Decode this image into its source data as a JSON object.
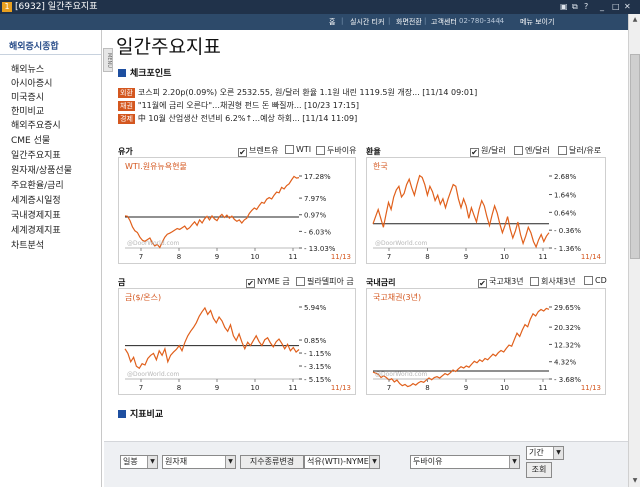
{
  "window": {
    "number": "1",
    "title": "[6932] 일간주요지표"
  },
  "topnav": {
    "items": [
      "홈",
      "실시간 티커",
      "화면전환",
      "고객센터"
    ],
    "phone": "02-780-3444",
    "menu": "메뉴 보이기"
  },
  "sidebar": {
    "header": "해외증시종합",
    "tab_label": "MENU",
    "items": [
      "해외뉴스",
      "아시아증시",
      "미국증시",
      "한미비교",
      "해외주요증시",
      "CME 선물",
      "일간주요지표",
      "원자재/상품선물",
      "주요환율/금리",
      "세계증시일정",
      "국내경제지표",
      "세계경제지표",
      "차트분석"
    ]
  },
  "page": {
    "title": "일간주요지표"
  },
  "checkpoint": {
    "title": "체크포인트",
    "news": [
      {
        "tag": "외환",
        "text": "코스피 2.20p(0.09%) 오른 2532.55, 원/달러 환율 1.1원 내린 1119.5원 개장... [11/14 09:01]"
      },
      {
        "tag": "채권",
        "text": "\"11월에 금리 오른다\"…채권형 펀드 돈 빠질까... [10/23 17:15]"
      },
      {
        "tag": "경제",
        "text": "中 10월 산업생산 전년비 6.2%↑…예상 하회... [11/14 11:09]"
      }
    ]
  },
  "panels": {
    "oil": {
      "title": "유가",
      "options": [
        {
          "label": "브렌트유",
          "checked": true
        },
        {
          "label": "WTI",
          "checked": false
        },
        {
          "label": "두바이유",
          "checked": false
        }
      ],
      "series_label": "WTI.원유뉴욕현물",
      "date": "11/13"
    },
    "fx": {
      "title": "환율",
      "options": [
        {
          "label": "원/달러",
          "checked": true
        },
        {
          "label": "엔/달러",
          "checked": false
        },
        {
          "label": "달러/유로",
          "checked": false
        }
      ],
      "series_label": "한국",
      "date": "11/14"
    },
    "gold": {
      "title": "금",
      "options": [
        {
          "label": "NYME 금",
          "checked": true
        },
        {
          "label": "필라델피아 금",
          "checked": false
        }
      ],
      "series_label": "금($/온스)",
      "date": "11/13"
    },
    "rate": {
      "title": "국내금리",
      "options": [
        {
          "label": "국고채3년",
          "checked": true
        },
        {
          "label": "회사채3년",
          "checked": false
        },
        {
          "label": "CD",
          "checked": false
        }
      ],
      "series_label": "국고채권(3년)",
      "date": "11/13"
    }
  },
  "compare": {
    "title": "지표비교"
  },
  "controls": {
    "period": "일봉",
    "category": "원자재",
    "change_button": "지수종류변경",
    "left_index": "석유(WTI)-NYMEX",
    "right_index": "두바이유",
    "period2_label": "기간",
    "query_button": "조회"
  },
  "watermark": "@DoorWorld.com",
  "chart_data": [
    {
      "type": "line",
      "title": "유가",
      "series": [
        {
          "name": "WTI.원유뉴욕현물",
          "values": [
            0.5,
            0.3,
            -1.5,
            -4.2,
            -5.8,
            -6.5,
            -8.5,
            -9.8,
            -10.2,
            -9.5,
            -8.8,
            -10.8,
            -12.2,
            -11.5,
            -12.8,
            -10.5,
            -8.5,
            -7.2,
            -6.8,
            -6.2,
            -5.5,
            -4.8,
            -5.2,
            -4.5,
            -3.8,
            -5.2,
            -4.5,
            -3.2,
            -2.0,
            -3.5,
            -1.2,
            -2.5,
            -0.8,
            0.3,
            -1.2,
            0.5,
            -0.8,
            -1.5,
            0.2,
            1.1,
            -0.2,
            0.8,
            -0.5,
            0.4,
            -1.0,
            -1.8,
            -1.2,
            -2.5,
            -1.2,
            -0.5,
            1.5,
            2.8,
            3.8,
            3.2,
            4.8,
            6.2,
            5.8,
            7.5,
            8.2,
            7.6,
            9.2,
            10.5,
            10.2,
            12.5,
            11.8,
            13.2,
            14.0,
            15.6,
            17.1,
            16.4,
            16.6
          ]
        }
      ],
      "x_ticks": [
        "7",
        "8",
        "9",
        "10",
        "11"
      ],
      "y_ticks": [
        17.28,
        7.97,
        0.97,
        -6.03,
        -13.03
      ],
      "y_unit": "%"
    },
    {
      "type": "line",
      "title": "환율",
      "series": [
        {
          "name": "한국",
          "values": [
            0.0,
            0.4,
            0.8,
            0.3,
            -0.2,
            0.5,
            1.2,
            0.8,
            1.5,
            1.9,
            2.1,
            1.5,
            1.7,
            2.2,
            2.5,
            2.0,
            1.6,
            2.2,
            2.7,
            2.6,
            2.2,
            1.6,
            2.1,
            1.8,
            1.3,
            1.6,
            1.1,
            1.4,
            0.9,
            1.4,
            1.8,
            2.2,
            2.1,
            1.4,
            0.9,
            1.4,
            1.0,
            0.3,
            0.9,
            0.5,
            0.1,
            0.8,
            1.3,
            1.0,
            0.4,
            -0.1,
            0.5,
            1.0,
            0.6,
            0.0,
            -0.5,
            -0.1,
            0.4,
            -0.3,
            -0.8,
            -0.4,
            0.1,
            -0.6,
            -1.1,
            -0.7,
            -0.2,
            -0.5,
            -1.0,
            -1.3,
            -0.9,
            -0.6,
            -1.0,
            -0.7,
            -0.5
          ]
        }
      ],
      "x_ticks": [
        "7",
        "8",
        "9",
        "10",
        "11"
      ],
      "y_ticks": [
        2.68,
        1.64,
        0.64,
        -0.36,
        -1.36
      ],
      "y_unit": "%"
    },
    {
      "type": "line",
      "title": "금",
      "series": [
        {
          "name": "금($/온스)",
          "values": [
            -0.5,
            -1.2,
            -2.5,
            -1.8,
            -3.2,
            -3.5,
            -2.8,
            -3.0,
            -2.0,
            -1.5,
            -1.2,
            -2.2,
            -0.8,
            -1.5,
            -0.5,
            -2.5,
            -1.5,
            -1.0,
            -0.6,
            0.0,
            -0.8,
            0.5,
            1.5,
            2.2,
            2.8,
            3.5,
            4.5,
            5.2,
            5.8,
            4.8,
            5.4,
            4.2,
            3.5,
            4.4,
            3.8,
            2.8,
            2.2,
            3.2,
            1.5,
            0.8,
            1.8,
            0.5,
            -0.5,
            0.5,
            0.0,
            0.8,
            1.5,
            0.6,
            0.0,
            0.9,
            1.2,
            0.4,
            -0.2,
            0.6,
            1.0,
            0.3,
            -0.5,
            0.2,
            -0.8,
            -0.3,
            -1.0,
            -0.6
          ]
        }
      ],
      "x_ticks": [
        "7",
        "8",
        "9",
        "10",
        "11"
      ],
      "y_ticks": [
        5.94,
        0.85,
        -1.15,
        -3.15,
        -5.15
      ],
      "y_unit": "%"
    },
    {
      "type": "line",
      "title": "국내금리",
      "series": [
        {
          "name": "국고채권(3년)",
          "values": [
            -0.5,
            -1.0,
            -1.5,
            -3.0,
            -2.2,
            -3.0,
            -4.2,
            -3.6,
            -5.0,
            -4.2,
            -5.8,
            -6.8,
            -6.2,
            -7.2,
            -6.8,
            -5.8,
            -6.5,
            -5.5,
            -4.8,
            -5.2,
            -4.2,
            -3.2,
            -4.0,
            -3.0,
            -2.6,
            -3.2,
            -2.2,
            -1.2,
            -1.8,
            -0.8,
            0.5,
            -0.2,
            1.0,
            2.0,
            1.4,
            2.4,
            1.8,
            3.2,
            4.5,
            3.8,
            5.2,
            4.4,
            5.8,
            5.2,
            6.5,
            7.8,
            7.0,
            8.5,
            9.5,
            8.8,
            10.5,
            12.0,
            11.5,
            14.5,
            17.5,
            16.0,
            19.0,
            21.5,
            20.5,
            24.0,
            26.5,
            25.5,
            27.5,
            28.5,
            27.8,
            29.0,
            28.6
          ]
        }
      ],
      "x_ticks": [
        "7",
        "8",
        "9",
        "10",
        "11"
      ],
      "y_ticks": [
        29.65,
        20.32,
        12.32,
        4.32,
        -3.68
      ],
      "y_unit": "%"
    }
  ]
}
